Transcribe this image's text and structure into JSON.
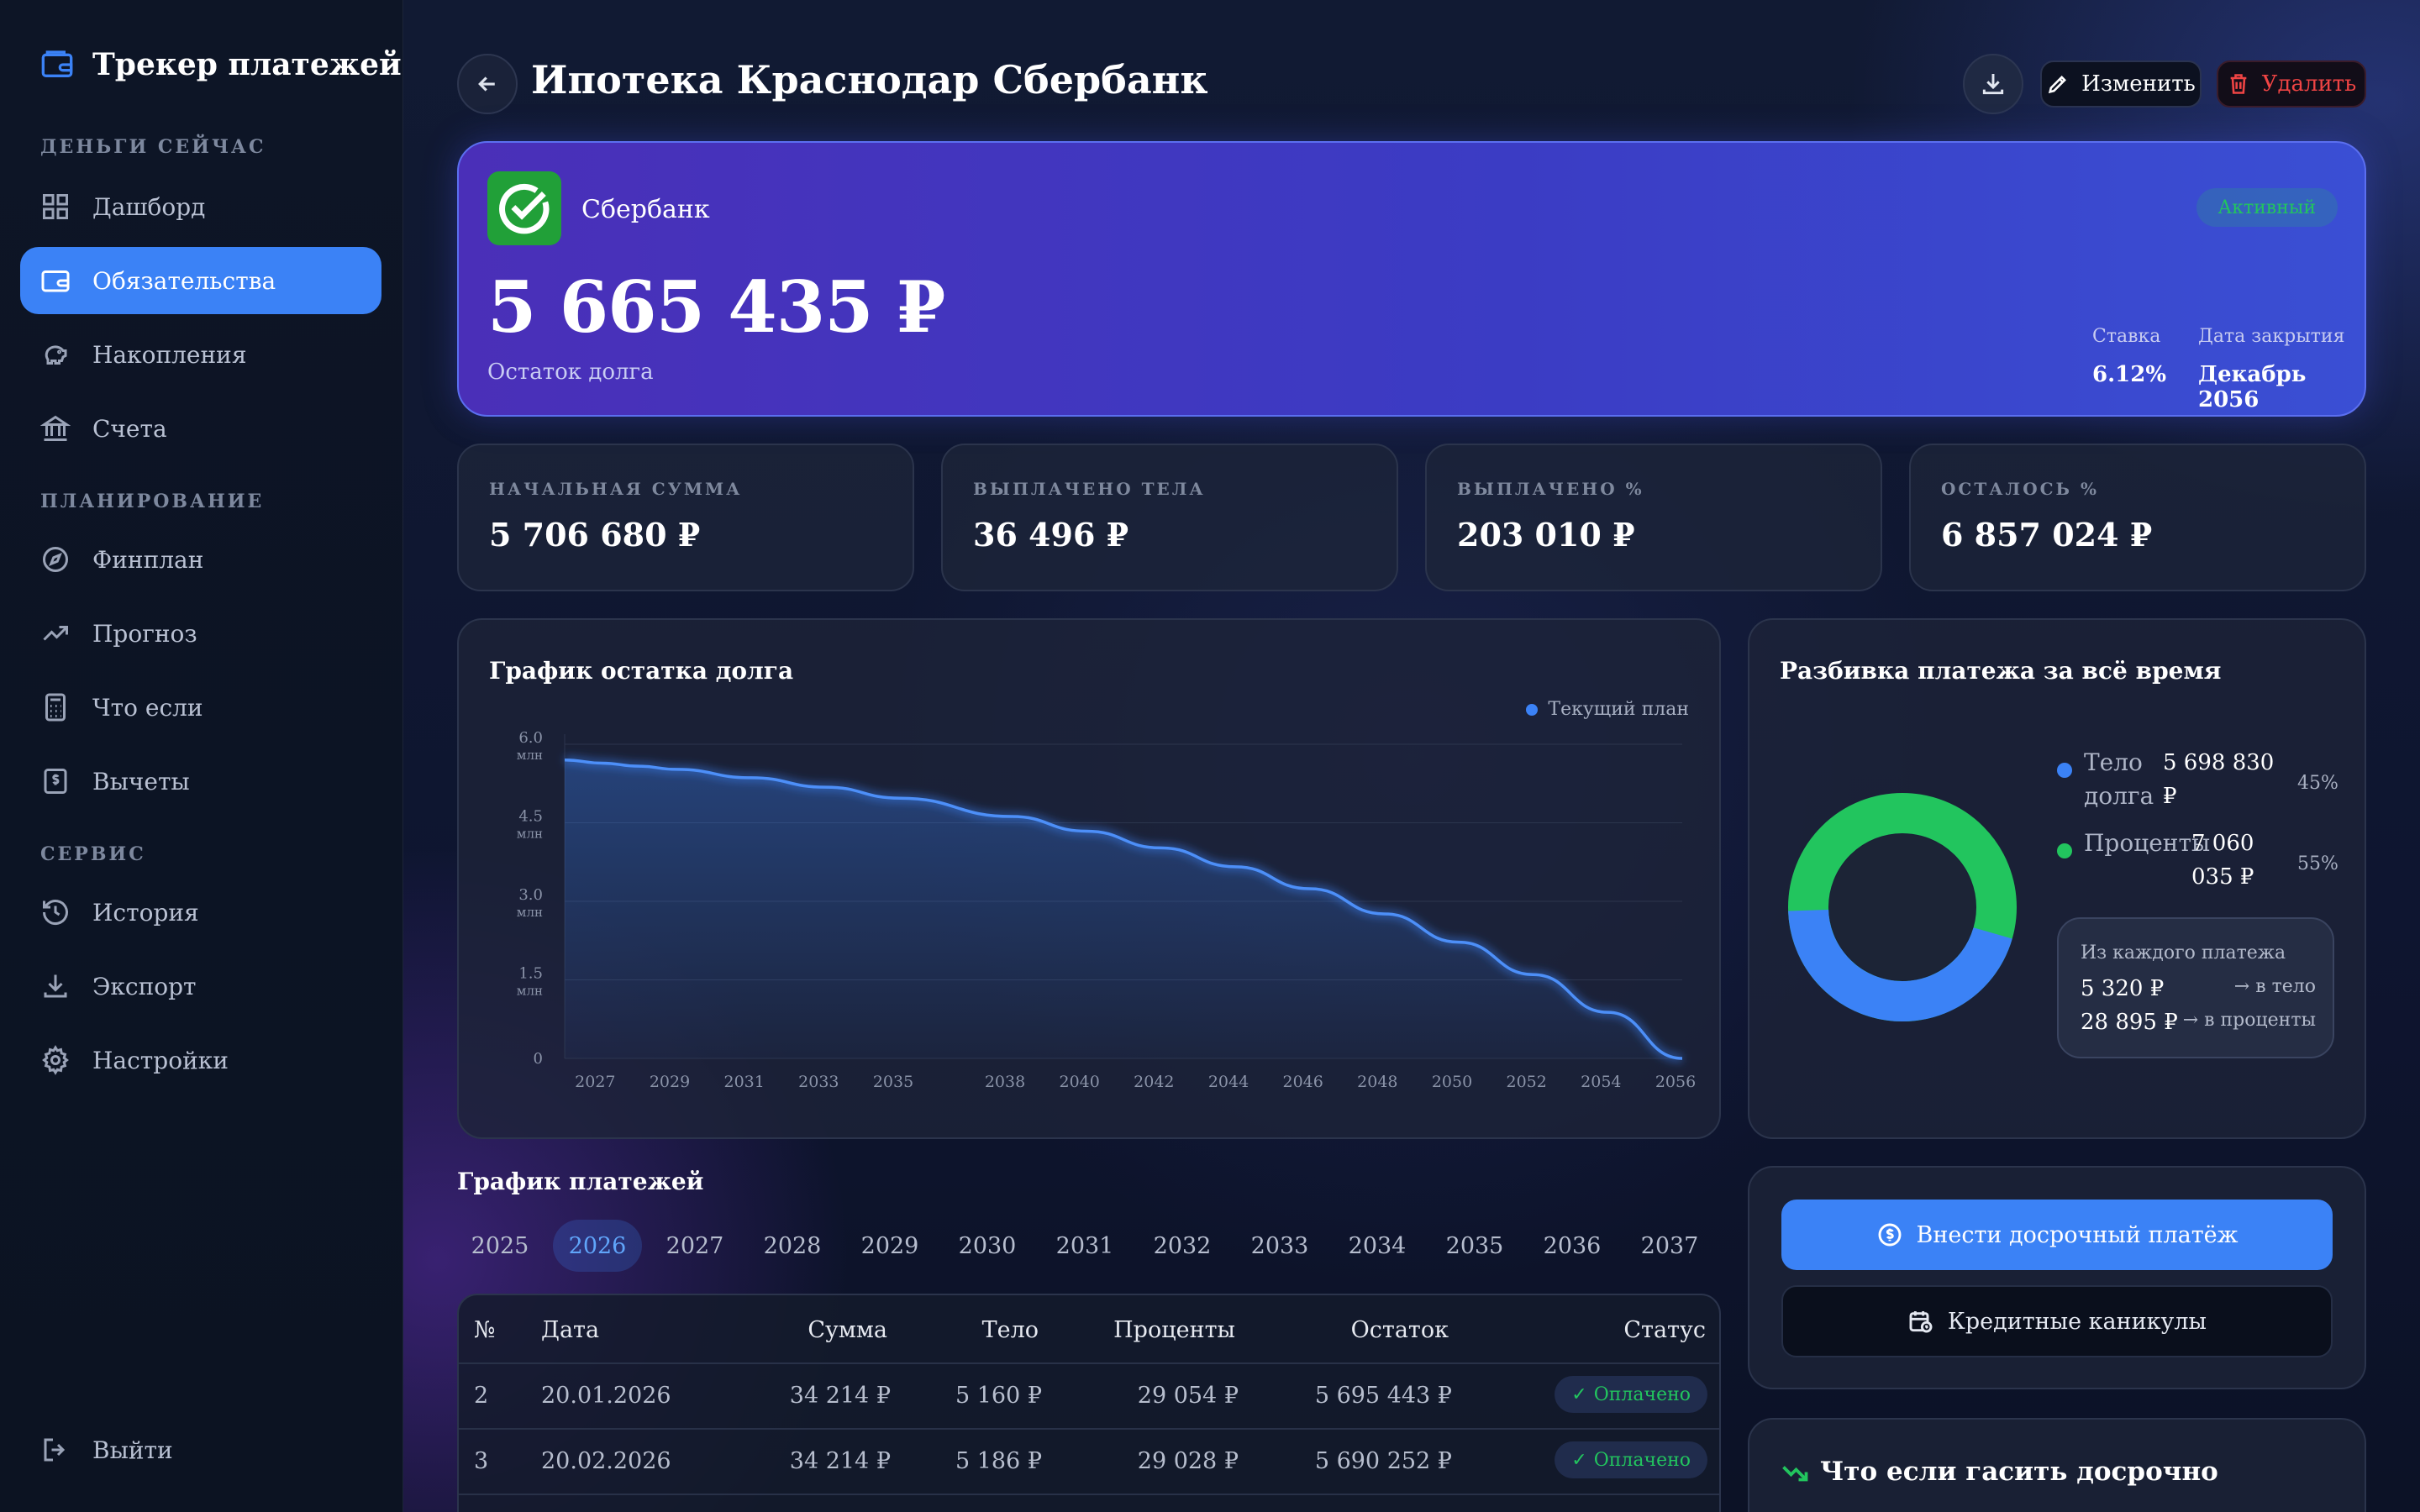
{
  "sidebar": {
    "brand": "Трекер платежей",
    "sections": [
      "ДЕНЬГИ СЕЙЧАС",
      "ПЛАНИРОВАНИЕ",
      "СЕРВИС"
    ],
    "items": [
      {
        "label": "Дашборд",
        "icon": "dashboard-icon"
      },
      {
        "label": "Обязательства",
        "icon": "wallet-icon",
        "active": true
      },
      {
        "label": "Накопления",
        "icon": "piggy-bank-icon"
      },
      {
        "label": "Счета",
        "icon": "bank-icon"
      },
      {
        "label": "Финплан",
        "icon": "compass-icon"
      },
      {
        "label": "Прогноз",
        "icon": "trend-up-icon"
      },
      {
        "label": "Что если",
        "icon": "calculator-icon"
      },
      {
        "label": "Вычеты",
        "icon": "receipt-icon"
      },
      {
        "label": "История",
        "icon": "history-icon"
      },
      {
        "label": "Экспорт",
        "icon": "download-icon"
      },
      {
        "label": "Настройки",
        "icon": "gear-icon"
      }
    ],
    "logout": "Выйти"
  },
  "header": {
    "title": "Ипотека Краснодар Сбербанк",
    "edit_label": "Изменить",
    "delete_label": "Удалить"
  },
  "hero": {
    "bank": "Сбербанк",
    "status": "Активный",
    "amount": "5 665 435 ₽",
    "amount_label": "Остаток долга",
    "rate_label": "Ставка",
    "rate": "6.12%",
    "close_label": "Дата закрытия",
    "close_date": "Декабрь 2056",
    "accent": "#21a038"
  },
  "stats": [
    {
      "label": "НАЧАЛЬНАЯ СУММА",
      "value": "5 706 680 ₽"
    },
    {
      "label": "ВЫПЛАЧЕНО ТЕЛА",
      "value": "36 496 ₽"
    },
    {
      "label": "ВЫПЛАЧЕНО %",
      "value": "203 010 ₽"
    },
    {
      "label": "ОСТАЛОСЬ %",
      "value": "6 857 024 ₽"
    }
  ],
  "chart_data": {
    "type": "area",
    "title": "График остатка долга",
    "series": [
      {
        "name": "Текущий план",
        "color": "#3b82f6"
      }
    ],
    "x": [
      2026,
      2027,
      2028,
      2029,
      2031,
      2033,
      2035,
      2038,
      2040,
      2042,
      2044,
      2046,
      2048,
      2050,
      2052,
      2054,
      2056
    ],
    "y": [
      5.7,
      5.64,
      5.58,
      5.52,
      5.36,
      5.18,
      4.97,
      4.62,
      4.34,
      4.02,
      3.66,
      3.24,
      2.76,
      2.22,
      1.6,
      0.88,
      0.0
    ],
    "x_ticks": [
      "2027",
      "2029",
      "2031",
      "2033",
      "2035",
      "2038",
      "2040",
      "2042",
      "2044",
      "2046",
      "2048",
      "2050",
      "2052",
      "2054",
      "2056"
    ],
    "y_ticks": [
      {
        "v": 6.0,
        "label": "6.0",
        "unit": "млн"
      },
      {
        "v": 4.5,
        "label": "4.5",
        "unit": "млн"
      },
      {
        "v": 3.0,
        "label": "3.0",
        "unit": "млн"
      },
      {
        "v": 1.5,
        "label": "1.5",
        "unit": "млн"
      },
      {
        "v": 0,
        "label": "0",
        "unit": ""
      }
    ],
    "ylim": [
      0,
      6.0
    ],
    "xlim": [
      2026,
      2056
    ],
    "legend": "top-right",
    "grid": true
  },
  "breakdown": {
    "title": "Разбивка платежа за всё время",
    "body_label": "Тело долга",
    "body_value": "5 698 830 ₽",
    "body_pct": "45%",
    "body_fraction": 0.45,
    "interest_label": "Проценты",
    "interest_value": "7 060 035 ₽",
    "interest_pct": "55%",
    "body_color": "#3b82f6",
    "interest_color": "#22c55e",
    "per_payment_title": "Из каждого платежа",
    "per_body": "5 320 ₽",
    "per_body_dest": "→ в тело",
    "per_interest": "28 895 ₽",
    "per_interest_dest": "→ в проценты"
  },
  "schedule": {
    "title": "График платежей",
    "years": [
      "2025",
      "2026",
      "2027",
      "2028",
      "2029",
      "2030",
      "2031",
      "2032",
      "2033",
      "2034",
      "2035",
      "2036",
      "2037"
    ],
    "active_year": "2026",
    "columns": [
      "№",
      "Дата",
      "Сумма",
      "Тело",
      "Проценты",
      "Остаток",
      "Статус"
    ],
    "rows": [
      {
        "n": "2",
        "date": "20.01.2026",
        "sum": "34 214 ₽",
        "body": "5 160 ₽",
        "interest": "29 054 ₽",
        "rest": "5 695 443 ₽",
        "status": "Оплачено"
      },
      {
        "n": "3",
        "date": "20.02.2026",
        "sum": "34 214 ₽",
        "body": "5 186 ₽",
        "interest": "29 028 ₽",
        "rest": "5 690 252 ₽",
        "status": "Оплачено"
      }
    ]
  },
  "actions": {
    "early_payment": "Внести досрочный платёж",
    "holidays": "Кредитные каникулы",
    "whatif_title": "Что если гасить досрочно"
  }
}
